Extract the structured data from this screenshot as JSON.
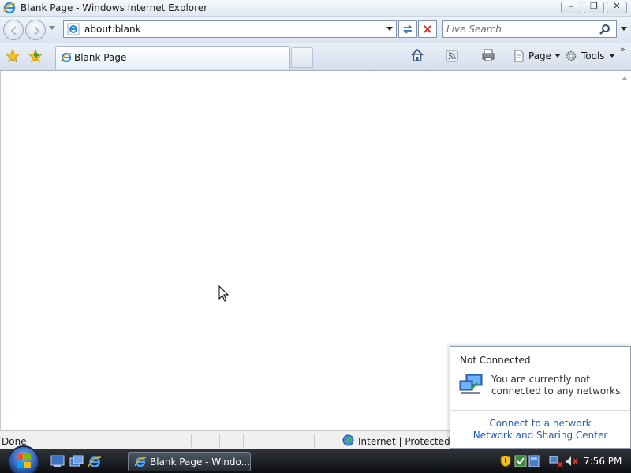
{
  "window": {
    "title": "Blank Page - Windows Internet Explorer",
    "caption_buttons": [
      "minimize",
      "restore",
      "close"
    ]
  },
  "address_bar": {
    "url": "about:blank",
    "search_placeholder": "Live Search"
  },
  "command_bar": {
    "tab_label": "Blank Page",
    "page_label": "Page",
    "tools_label": "Tools"
  },
  "status_bar": {
    "status": "Done",
    "zone": "Internet | Protected M"
  },
  "taskbar": {
    "task_label": "Blank Page - Windo...",
    "clock": "7:56 PM"
  },
  "network_popup": {
    "title": "Not Connected",
    "message": "You are currently not connected to any networks.",
    "link_connect": "Connect to a network",
    "link_center": "Network and Sharing Center"
  },
  "colors": {
    "accent": "#2c5fb2",
    "link": "#1f5fa8",
    "taskbar": "#1b1e22"
  }
}
